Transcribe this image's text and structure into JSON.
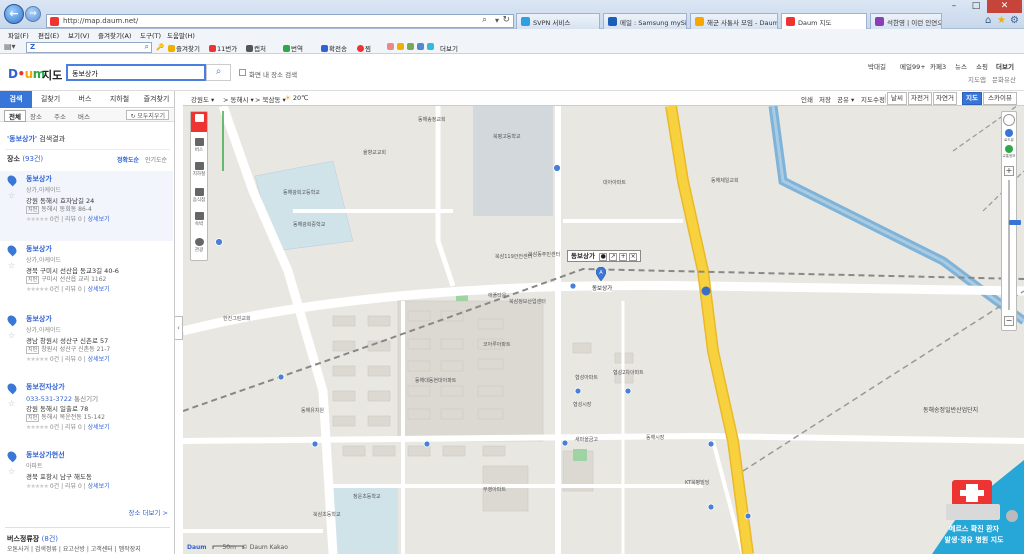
{
  "browser": {
    "url": "http://map.daum.net/",
    "tabs": [
      {
        "label": "SVPN 서비스",
        "color": "#2da0e0",
        "active": false
      },
      {
        "label": "메일 : Samsung mySingle",
        "color": "#1b5fb8",
        "active": false
      },
      {
        "label": "해군 사통사 모임 - Daum...",
        "color": "#f6a800",
        "active": false
      },
      {
        "label": "Daum 지도",
        "color": "#e33",
        "active": true
      },
      {
        "label": "석한영 | 이런 인연으로 -",
        "color": "#8a3fb8",
        "active": false
      }
    ],
    "menu": [
      "파일(F)",
      "편집(E)",
      "보기(V)",
      "즐겨찾기(A)",
      "도구(T)",
      "도움말(H)"
    ],
    "toolbar": {
      "search_value": "Z",
      "items": [
        "즐겨찾기",
        "11번가",
        "캡처",
        "번역",
        "확전송",
        "찜",
        "",
        "",
        "",
        "",
        "더보기"
      ]
    }
  },
  "header": {
    "logo_parts": [
      "D",
      "a",
      "u",
      "m"
    ],
    "logo_sub": "지도",
    "search_value": "동보상가",
    "in_screen_label": "화면 내 장소 검색",
    "links_row1": [
      "박대길",
      "메일99+",
      "카페3",
      "뉴스",
      "쇼핑",
      "더보기"
    ],
    "links_row2": [
      "지도앱",
      "문화유산"
    ]
  },
  "left_panel": {
    "main_tabs": [
      "검색",
      "길찾기",
      "버스",
      "지하철",
      "즐겨찾기"
    ],
    "sub_tabs": [
      "전체",
      "장소",
      "주소",
      "버스"
    ],
    "collapse_all": "모두지우기",
    "result_query": "'동보상가'",
    "result_suffix": "검색결과",
    "place_label": "장소",
    "place_count": "(93건)",
    "sort_accuracy": "정확도순",
    "sort_popular": "인기도순",
    "results": [
      {
        "title": "동보상가",
        "category": "상가,아케이드",
        "address": "강원 동해시 효자남길 24",
        "jibun": "동해시 동회동 86-4",
        "reviews": "0건",
        "review_label": "리뷰 0",
        "detail": "상세보기"
      },
      {
        "title": "동보상가",
        "category": "상가,아케이드",
        "address": "경북 구미시 선산읍 동교3길 40-6",
        "jibun": "구미시 선산읍 교리 1162",
        "reviews": "0건",
        "review_label": "리뷰 0",
        "detail": "상세보기"
      },
      {
        "title": "동보상가",
        "category": "상가,아케이드",
        "address": "경남 창원시 성산구 신촌로 57",
        "jibun": "창원시 성산구 신촌동 21-7",
        "reviews": "0건",
        "review_label": "리뷰 0",
        "detail": "상세보기"
      },
      {
        "title": "동보전자상가",
        "phone": "033-531-3722",
        "phone_sub": "통신기기",
        "address": "강원 동해시 일출로 78",
        "jibun": "동해시 목운전동 15-142",
        "reviews": "0건",
        "review_label": "리뷰 0",
        "detail": "상세보기"
      },
      {
        "title": "동보상가현선",
        "category": "아파트",
        "address": "경북 포항시 남구 해도동",
        "reviews": "0건",
        "review_label": "리뷰 0",
        "detail": "상세보기"
      }
    ],
    "jibun_tag": "지번",
    "more_places": "장소 더보기 >",
    "bus_stop_label": "버스정류장",
    "bus_stop_count": "(8건)",
    "bus_stop_row": "오톤사거 | 검색정류 | 요고산방 | 고객센터 | 멤작장지"
  },
  "map": {
    "breadcrumbs": [
      "강원도",
      "동해시",
      "북삼동"
    ],
    "weather": "20℃",
    "options": [
      "인쇄",
      "저장",
      "공유",
      "지도수정"
    ],
    "view_buttons": [
      "날씨",
      "자전거",
      "자연거"
    ],
    "map_types": [
      {
        "label": "지도",
        "active": true
      },
      {
        "label": "스카이뷰",
        "active": false
      }
    ],
    "left_tools": [
      "버스",
      "지하철",
      "음식점",
      "숙박",
      "관광"
    ],
    "zoom_labels": [
      "로드뷰",
      "교통정보"
    ],
    "popup_title": "동보상가",
    "marker_label": "동보상가",
    "labels": [
      "동해광희고등학교",
      "동해광희중학교",
      "북평고등학교",
      "북삼119안전센터",
      "북삼동주민센터",
      "애플타운",
      "북삼정보산업센터",
      "동해대동현대아파트",
      "코아루아파트",
      "협성아파트",
      "협성2차아파트",
      "협성시장",
      "한진그린교회",
      "동해송정일반산업단지",
      "청운초등학교",
      "동해시장",
      "대아아파트",
      "북삼초등학교",
      "동해제일교회",
      "율향교교회",
      "KT북평빌딩",
      "동해유치원",
      "부영아파트",
      "동해송정교회",
      "새마을금고"
    ],
    "copyright": "© Daum Kakao",
    "scale": "50m",
    "brand": "Daum"
  },
  "ad": {
    "line1": "메르스 확진 환자",
    "line2": "발생·경유 병원 지도"
  },
  "colors": {
    "accent": "#3775d8",
    "link": "#2f62d6",
    "road_main": "#f7d23e",
    "river": "#7fb3d8",
    "ad_bg": "#27a7d8"
  }
}
